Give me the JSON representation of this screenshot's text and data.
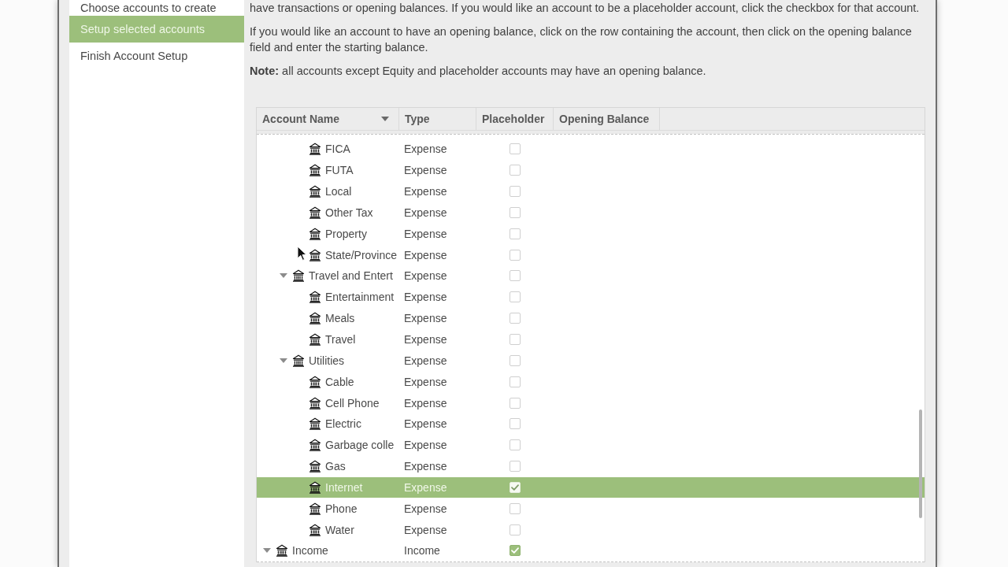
{
  "sidebar": {
    "items": [
      {
        "label": "Choose accounts to create",
        "selected": false
      },
      {
        "label": "Setup selected accounts",
        "selected": true
      },
      {
        "label": "Finish Account Setup",
        "selected": false
      }
    ]
  },
  "instructions": {
    "paragraphs": [
      "have transactions or opening balances. If you would like an account to be a placeholder account, click the checkbox for that account.",
      "If you would like an account to have an opening balance, click on the row containing the account, then click on the opening balance field and enter the starting balance."
    ],
    "note": "**Note:** all accounts except Equity and placeholder accounts may have an opening balance."
  },
  "tree": {
    "columns": [
      {
        "label": "Account Name",
        "sorted": true
      },
      {
        "label": "Type",
        "sorted": false
      },
      {
        "label": "Placeholder",
        "sorted": false
      },
      {
        "label": "Opening Balance",
        "sorted": false
      }
    ],
    "rows": [
      {
        "children": [
          {
            "children": [
              {
                "name": "FICA",
                "type": "Expense",
                "placeholder": false,
                "selected": false
              },
              {
                "name": "FUTA",
                "type": "Expense",
                "placeholder": false,
                "selected": false
              },
              {
                "name": "Local",
                "type": "Expense",
                "placeholder": false,
                "selected": false
              },
              {
                "name": "Other Tax",
                "type": "Expense",
                "placeholder": false,
                "selected": false
              },
              {
                "name": "Property",
                "type": "Expense",
                "placeholder": false,
                "selected": false
              },
              {
                "name": "State/Province",
                "type": "Expense",
                "placeholder": false,
                "selected": false
              }
            ]
          },
          {
            "name": "Travel and Entert",
            "type": "Expense",
            "placeholder": false,
            "selected": false,
            "expanded": true,
            "children": [
              {
                "name": "Entertainment",
                "type": "Expense",
                "placeholder": false,
                "selected": false
              },
              {
                "name": "Meals",
                "type": "Expense",
                "placeholder": false,
                "selected": false
              },
              {
                "name": "Travel",
                "type": "Expense",
                "placeholder": false,
                "selected": false
              }
            ]
          },
          {
            "name": "Utilities",
            "type": "Expense",
            "placeholder": false,
            "selected": false,
            "expanded": true,
            "children": [
              {
                "name": "Cable",
                "type": "Expense",
                "placeholder": false,
                "selected": false
              },
              {
                "name": "Cell Phone",
                "type": "Expense",
                "placeholder": false,
                "selected": false
              },
              {
                "name": "Electric",
                "type": "Expense",
                "placeholder": false,
                "selected": false
              },
              {
                "name": "Garbage colle",
                "type": "Expense",
                "placeholder": false,
                "selected": false
              },
              {
                "name": "Gas",
                "type": "Expense",
                "placeholder": false,
                "selected": false
              },
              {
                "name": "Internet",
                "type": "Expense",
                "placeholder": true,
                "selected": true
              },
              {
                "name": "Phone",
                "type": "Expense",
                "placeholder": false,
                "selected": false
              },
              {
                "name": "Water",
                "type": "Expense",
                "placeholder": false,
                "selected": false
              }
            ]
          }
        ]
      },
      {
        "name": "Income",
        "type": "Income",
        "placeholder": true,
        "selected": false,
        "expanded": true
      }
    ]
  }
}
